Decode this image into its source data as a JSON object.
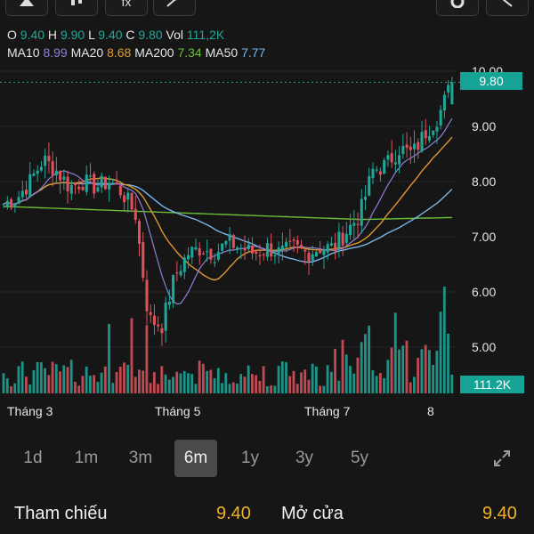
{
  "toolbar": {
    "buttons": [
      {
        "name": "chart-type-icon"
      },
      {
        "name": "candle-icon"
      },
      {
        "name": "indicator-fx-icon",
        "label": "fx"
      },
      {
        "name": "trend-icon"
      },
      {
        "name": "settings-icon"
      },
      {
        "name": "share-icon"
      }
    ]
  },
  "ohlc": {
    "o_label": "O",
    "o": "9.40",
    "h_label": "H",
    "h": "9.90",
    "l_label": "L",
    "l": "9.40",
    "c_label": "C",
    "c": "9.80",
    "vol_label": "Vol",
    "vol": "111,2K"
  },
  "ma": {
    "ma10_label": "MA10",
    "ma10": "8.99",
    "ma20_label": "MA20",
    "ma20": "8.68",
    "ma200_label": "MA200",
    "ma200": "7.34",
    "ma50_label": "MA50",
    "ma50": "7.77"
  },
  "colors": {
    "up": "#1fa89a",
    "down": "#e0515c",
    "ma10": "#8e7fd6",
    "ma20": "#e0982e",
    "ma200": "#6cbf3a",
    "ma50": "#78b6e8"
  },
  "price_axis": {
    "ticks": [
      "10.00",
      "9.00",
      "8.00",
      "7.00",
      "6.00",
      "5.00"
    ],
    "last_price": "9.80"
  },
  "volume_tag": "111.2K",
  "time_axis": {
    "labels": [
      "Tháng 3",
      "Tháng 5",
      "Tháng 7",
      "8"
    ]
  },
  "chart_data": {
    "type": "candlestick",
    "last": {
      "open": 9.4,
      "high": 9.9,
      "low": 9.4,
      "close": 9.8,
      "volume": "111,2K"
    },
    "moving_averages": {
      "MA10": 8.99,
      "MA20": 8.68,
      "MA200": 7.34,
      "MA50": 7.77
    },
    "ylim": [
      4.7,
      10.2
    ],
    "y_ticks": [
      10.0,
      9.0,
      8.0,
      7.0,
      6.0,
      5.0
    ],
    "x_labels": [
      "Tháng 3",
      "Tháng 5",
      "Tháng 7",
      "8"
    ],
    "anchor_closes": [
      7.6,
      7.7,
      8.0,
      8.4,
      8.2,
      7.9,
      8.0,
      7.9,
      8.0,
      7.8,
      7.4,
      5.5,
      5.4,
      6.3,
      6.7,
      6.8,
      6.7,
      6.9,
      6.8,
      6.7,
      6.8,
      6.7,
      6.8,
      6.7,
      6.8,
      6.8,
      7.1,
      7.4,
      8.2,
      8.3,
      8.6,
      8.5,
      8.9,
      9.2,
      9.8
    ]
  },
  "range_tabs": [
    "1d",
    "1m",
    "3m",
    "6m",
    "1y",
    "3y",
    "5y"
  ],
  "range_active": "6m",
  "quote": {
    "ref_label": "Tham chiếu",
    "ref_value": "9.40",
    "open_label": "Mở cửa",
    "open_value": "9.40"
  }
}
